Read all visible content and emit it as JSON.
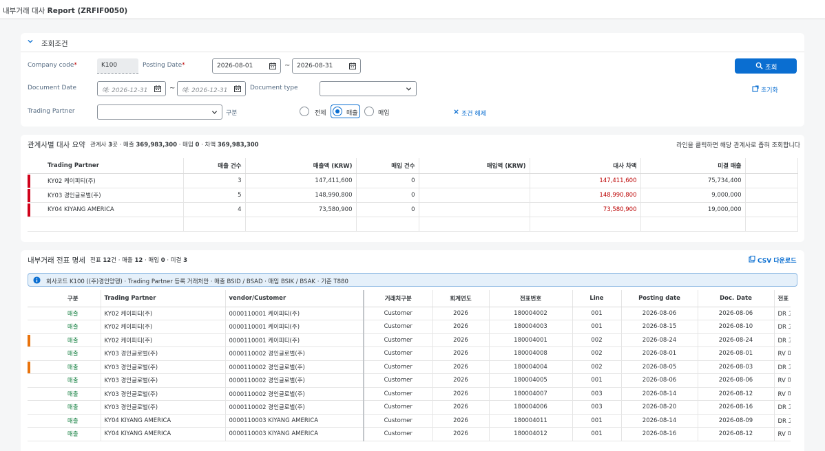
{
  "window": {
    "title_prefix": "내부거래 대사",
    "title_bold": "Report (ZRFIF0050)"
  },
  "filter": {
    "section_title": "조회조건",
    "company_code_label": "Company code",
    "company_code_value": "K100",
    "posting_date_label": "Posting Date",
    "posting_from": "2026-08-01",
    "posting_to": "2026-08-31",
    "document_date_label": "Document Date",
    "doc_from_placeholder": "예: 2026-12-31",
    "doc_to_placeholder": "예: 2026-12-31",
    "document_type_label": "Document type",
    "document_type_value": "",
    "trading_partner_label": "Trading Partner",
    "trading_partner_value": "",
    "gubun_label": "구분",
    "radio_all": "전체",
    "radio_sales": "매출",
    "radio_purchase": "매입",
    "selected_radio": "매출",
    "clear_label": "조건 해제",
    "search_label": "조회",
    "reset_label": "초기화",
    "tilde": "~"
  },
  "summary": {
    "title": "관계사별 대사 요약",
    "stats_prefix": "관계사 ",
    "stats_partners": "3",
    "stats_sales_mid": "곳 · 매출 ",
    "stats_sales": "369,983,300",
    "stats_purchase_mid": " · 매입 ",
    "stats_purchase": "0",
    "stats_diff_mid": " · 차액 ",
    "stats_diff": "369,983,300",
    "hint": "라인을 클릭하면 해당 관계사로 좁혀 조회합니다",
    "columns": [
      "Trading Partner",
      "매출 건수",
      "매출액 (KRW)",
      "매입 건수",
      "매입액 (KRW)",
      "대사 차액",
      "미결 매출"
    ],
    "rows": [
      {
        "partner": "KY02 케이피티(주)",
        "sales_cnt": "3",
        "sales_amt": "147,411,600",
        "pur_cnt": "0",
        "pur_amt": "",
        "diff": "147,411,600",
        "open": "75,734,400"
      },
      {
        "partner": "KY03 경인글로벌(주)",
        "sales_cnt": "5",
        "sales_amt": "148,990,800",
        "pur_cnt": "0",
        "pur_amt": "",
        "diff": "148,990,800",
        "open": "9,000,000"
      },
      {
        "partner": "KY04 KIYANG AMERICA",
        "sales_cnt": "4",
        "sales_amt": "73,580,900",
        "pur_cnt": "0",
        "pur_amt": "",
        "diff": "73,580,900",
        "open": "19,000,000"
      }
    ],
    "marker_color": "#d0021b"
  },
  "detail": {
    "title": "내부거래 전표 명세",
    "stats_prefix": "전표 ",
    "stats_docs": "12",
    "stats_sales_mid": "건 · 매출 ",
    "stats_sales": "12",
    "stats_purchase_mid": " · 매입 ",
    "stats_purchase": "0",
    "stats_open_mid": " · 미결 ",
    "stats_open": "3",
    "csv_label": "CSV 다운로드",
    "info": "회사코드 K100 ((주)경인양행) · Trading Partner 등록 거래처만 · 매출 BSID / BSAD · 매입 BSIK / BSAK · 기준 T880",
    "columns": [
      "구분",
      "Trading Partner",
      "vendor/Customer",
      "거래처구분",
      "회계연도",
      "전표번호",
      "Line",
      "Posting date",
      "Doc. Date",
      "전표"
    ],
    "rows": [
      {
        "mark": false,
        "gubun": "매출",
        "partner": "KY02 케이피티(주)",
        "vendor": "0000110001 케이피티(주)",
        "type": "Customer",
        "year": "2026",
        "doc": "180004002",
        "line": "001",
        "post": "2026-08-06",
        "docdate": "2026-08-06",
        "dtype": "DR 고"
      },
      {
        "mark": false,
        "gubun": "매출",
        "partner": "KY02 케이피티(주)",
        "vendor": "0000110001 케이피티(주)",
        "type": "Customer",
        "year": "2026",
        "doc": "180004003",
        "line": "001",
        "post": "2026-08-15",
        "docdate": "2026-08-10",
        "dtype": "DR 고"
      },
      {
        "mark": true,
        "gubun": "매출",
        "partner": "KY02 케이피티(주)",
        "vendor": "0000110001 케이피티(주)",
        "type": "Customer",
        "year": "2026",
        "doc": "180004001",
        "line": "002",
        "post": "2026-08-24",
        "docdate": "2026-08-24",
        "dtype": "DR 고"
      },
      {
        "mark": false,
        "gubun": "매출",
        "partner": "KY03 경인글로벌(주)",
        "vendor": "0000110002 경인글로벌(주)",
        "type": "Customer",
        "year": "2026",
        "doc": "180004008",
        "line": "002",
        "post": "2026-08-01",
        "docdate": "2026-08-01",
        "dtype": "RV 미"
      },
      {
        "mark": true,
        "gubun": "매출",
        "partner": "KY03 경인글로벌(주)",
        "vendor": "0000110002 경인글로벌(주)",
        "type": "Customer",
        "year": "2026",
        "doc": "180004004",
        "line": "002",
        "post": "2026-08-05",
        "docdate": "2026-08-03",
        "dtype": "DR 고"
      },
      {
        "mark": false,
        "gubun": "매출",
        "partner": "KY03 경인글로벌(주)",
        "vendor": "0000110002 경인글로벌(주)",
        "type": "Customer",
        "year": "2026",
        "doc": "180004005",
        "line": "001",
        "post": "2026-08-06",
        "docdate": "2026-08-06",
        "dtype": "RV 미"
      },
      {
        "mark": false,
        "gubun": "매출",
        "partner": "KY03 경인글로벌(주)",
        "vendor": "0000110002 경인글로벌(주)",
        "type": "Customer",
        "year": "2026",
        "doc": "180004007",
        "line": "003",
        "post": "2026-08-14",
        "docdate": "2026-08-12",
        "dtype": "RV 미"
      },
      {
        "mark": false,
        "gubun": "매출",
        "partner": "KY03 경인글로벌(주)",
        "vendor": "0000110002 경인글로벌(주)",
        "type": "Customer",
        "year": "2026",
        "doc": "180004006",
        "line": "003",
        "post": "2026-08-20",
        "docdate": "2026-08-16",
        "dtype": "DR 고"
      },
      {
        "mark": false,
        "gubun": "매출",
        "partner": "KY04 KIYANG AMERICA",
        "vendor": "0000110003 KIYANG AMERICA",
        "type": "Customer",
        "year": "2026",
        "doc": "180004011",
        "line": "001",
        "post": "2026-08-14",
        "docdate": "2026-08-09",
        "dtype": "DR 고"
      },
      {
        "mark": false,
        "gubun": "매출",
        "partner": "KY04 KIYANG AMERICA",
        "vendor": "0000110003 KIYANG AMERICA",
        "type": "Customer",
        "year": "2026",
        "doc": "180004012",
        "line": "001",
        "post": "2026-08-16",
        "docdate": "2026-08-12",
        "dtype": "RV 미"
      }
    ],
    "marker_color": "#e9730c"
  }
}
